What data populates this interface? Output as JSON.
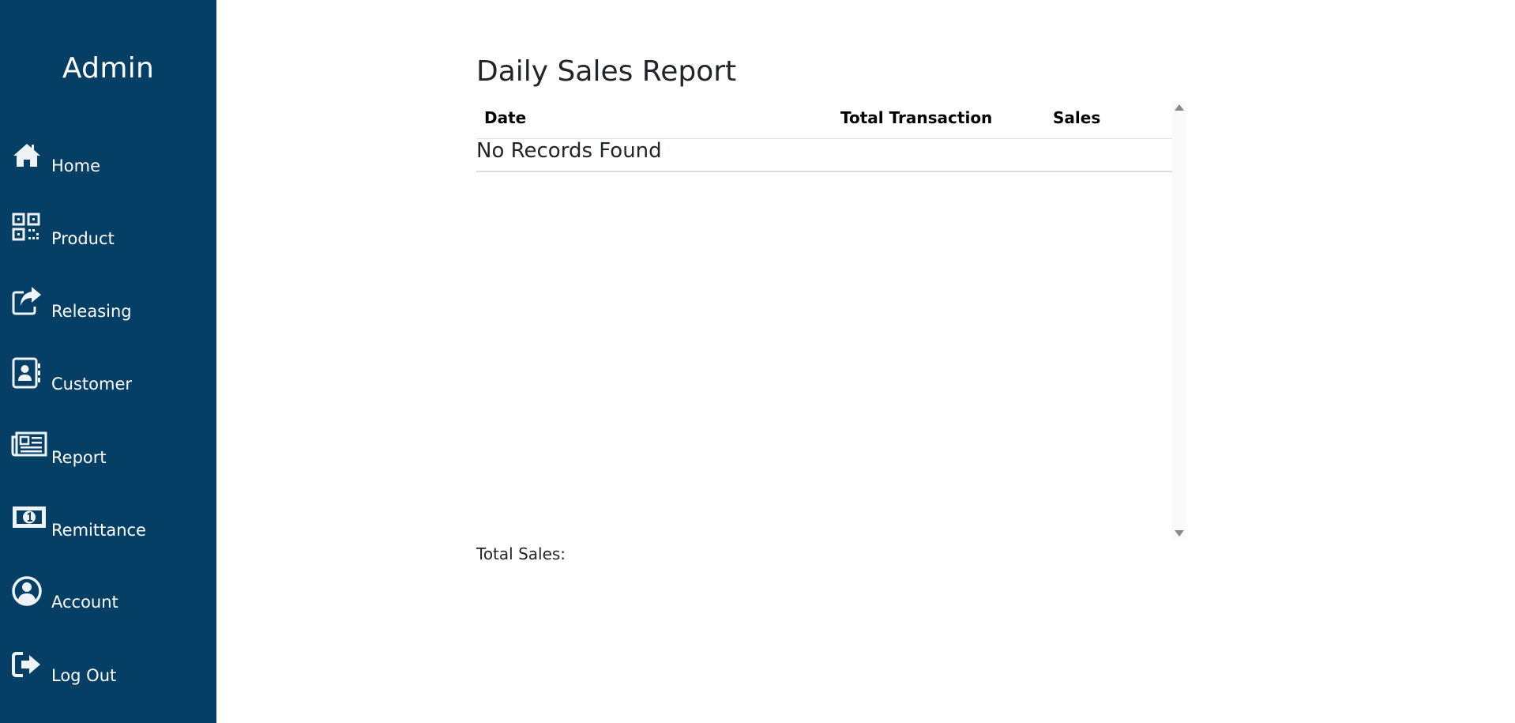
{
  "sidebar": {
    "brand": "Admin",
    "background_color": "#063f66",
    "items": [
      {
        "label": "Home",
        "icon": "home-icon"
      },
      {
        "label": "Product",
        "icon": "qrcode-icon"
      },
      {
        "label": "Releasing",
        "icon": "share-icon"
      },
      {
        "label": "Customer",
        "icon": "address-book-icon"
      },
      {
        "label": "Report",
        "icon": "newspaper-icon"
      },
      {
        "label": "Remittance",
        "icon": "money-bill-icon"
      },
      {
        "label": "Account",
        "icon": "user-circle-icon"
      },
      {
        "label": "Log Out",
        "icon": "sign-out-icon"
      }
    ]
  },
  "main": {
    "title": "Daily Sales Report",
    "table": {
      "columns": [
        "Date",
        "Total Transaction",
        "Sales"
      ],
      "empty_message": "No Records Found"
    },
    "total_sales_label": "Total Sales:"
  }
}
